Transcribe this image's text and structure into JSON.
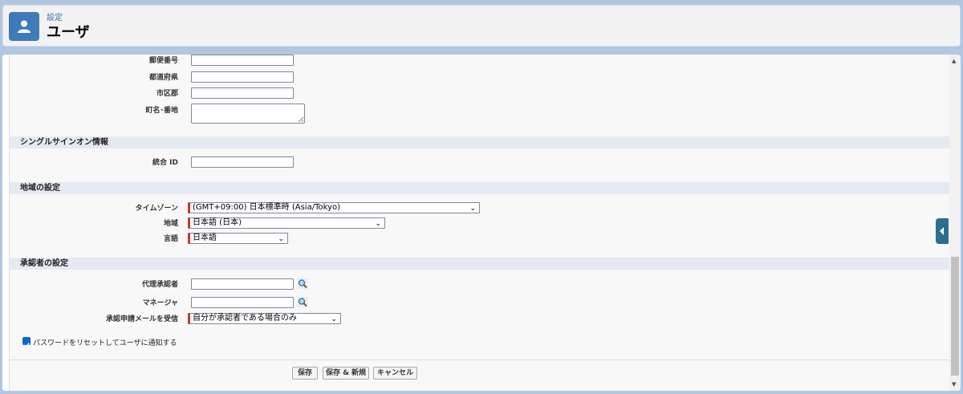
{
  "header": {
    "subtitle": "設定",
    "title": "ユーザ"
  },
  "address": {
    "postal_code_label": "郵便番号",
    "prefecture_label": "都道府県",
    "city_label": "市区郡",
    "street_label": "町名･番地"
  },
  "sso": {
    "section_title": "シングルサインオン情報",
    "federation_id_label": "統合 ID"
  },
  "locale": {
    "section_title": "地域の設定",
    "timezone_label": "タイムゾーン",
    "timezone_value": "(GMT+09:00) 日本標準時 (Asia/Tokyo)",
    "region_label": "地域",
    "region_value": "日本語 (日本)",
    "language_label": "言語",
    "language_value": "日本語"
  },
  "approver": {
    "section_title": "承認者の設定",
    "delegate_label": "代理承認者",
    "manager_label": "マネージャ",
    "email_label": "承認申請メールを受信",
    "email_value": "自分が承認者である場合のみ"
  },
  "reset_password": {
    "label": "パスワードをリセットしてユーザに通知する",
    "checked": true
  },
  "buttons": {
    "save": "保存",
    "save_new": "保存 & 新規",
    "cancel": "キャンセル"
  },
  "colors": {
    "accent": "#3e7cb8",
    "required": "#c23934",
    "checkbox": "#0b66d4"
  }
}
